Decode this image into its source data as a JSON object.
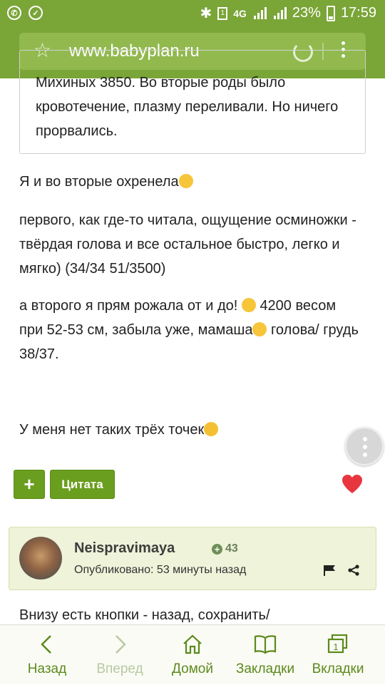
{
  "status_bar": {
    "network": "4G",
    "battery": "23%",
    "time": "17:59"
  },
  "browser": {
    "url": "www.babyplan.ru"
  },
  "post": {
    "quote_text": "Михиных 3850. Во вторые роды было кровотечение, плазму переливали. Но ничего прорвались.",
    "p1": "Я и во вторые охренела",
    "p2": "первого, как где-то читала, ощущение осминожки - твёрдая голова и все остальное быстро, легко и мягко) (34/34 51/3500)",
    "p3a": "а второго я прям рожала от и до!",
    "p3b": "4200 весом при 52-53 см, забыла уже, мамаша",
    "p3c": "голова/ грудь 38/37.",
    "p4": "У меня нет таких трёх точек",
    "plus_label": "+",
    "quote_label": "Цитата"
  },
  "author": {
    "name": "Neispravimaya",
    "reputation": "43",
    "published": "Опубликовано: 53 минуты назад"
  },
  "next_post": {
    "text_partial": "Внизу есть кнопки - назад, сохранить/"
  },
  "bottom_nav": {
    "back": "Назад",
    "forward": "Вперед",
    "home": "Домой",
    "bookmarks": "Закладки",
    "tabs": "Вкладки",
    "tabs_count": "1"
  },
  "colors": {
    "brand_green": "#7aa537",
    "button_green": "#6a9e1f",
    "heart_red": "#e8363f"
  }
}
